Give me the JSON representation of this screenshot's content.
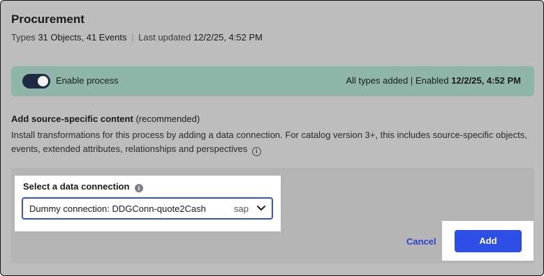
{
  "header": {
    "title": "Procurement",
    "types_label": "Types",
    "types_value": "31 Objects, 41 Events",
    "separator": "|",
    "updated_label": "Last updated",
    "updated_value": "12/2/25, 4:52 PM"
  },
  "banner": {
    "toggle_state": "on",
    "toggle_label": "Enable process",
    "status_text": "All types added",
    "status_separator": "|",
    "enabled_label": "Enabled",
    "enabled_value": "12/2/25, 4:52 PM",
    "background_color": "#8fb6a8"
  },
  "section": {
    "title_bold": "Add source-specific content",
    "title_suffix": "(recommended)",
    "description": "Install transformations for this process by adding a data connection. For catalog version 3+, this includes source-specific objects, events, extended attributes, relationships and perspectives",
    "info_icon": "info-icon"
  },
  "connection": {
    "label": "Select a data connection",
    "label_icon": "info-icon",
    "selected_value": "Dummy connection: DDGConn-quote2Cash",
    "selected_tag": "sap",
    "dropdown_icon": "chevron-down-icon"
  },
  "actions": {
    "cancel_label": "Cancel",
    "add_label": "Add",
    "primary_color": "#2d4fe8"
  }
}
